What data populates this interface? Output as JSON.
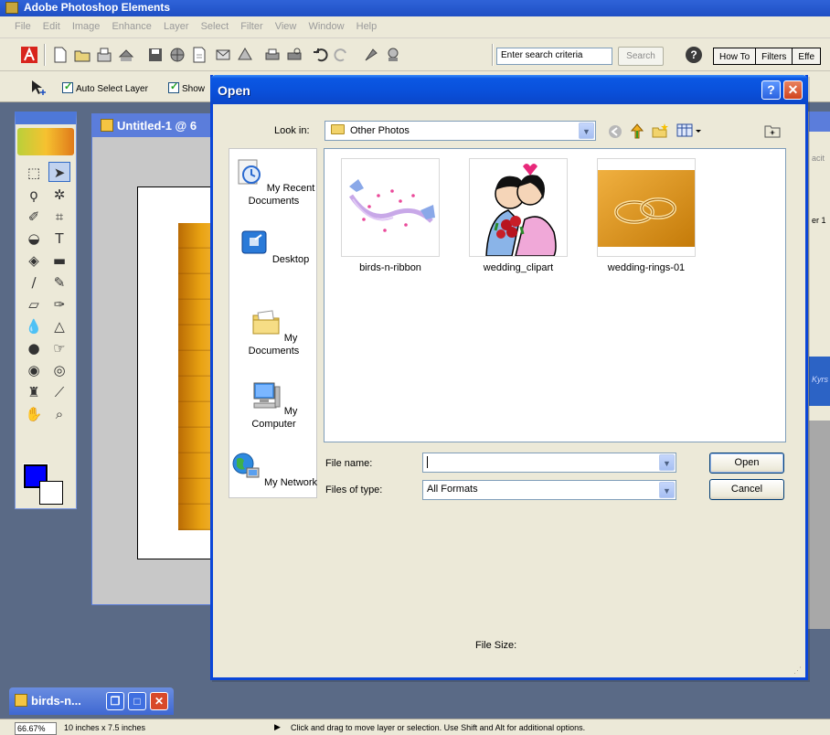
{
  "app": {
    "title": "Adobe Photoshop Elements",
    "menu": [
      "File",
      "Edit",
      "Image",
      "Enhance",
      "Layer",
      "Select",
      "Filter",
      "View",
      "Window",
      "Help"
    ],
    "search_placeholder": "Enter search criteria",
    "search_button": "Search",
    "help_glyph": "?",
    "palette_tabs": [
      "How To",
      "Filters",
      "Effe"
    ],
    "options": {
      "auto_select_layer": "Auto Select Layer",
      "show": "Show"
    },
    "document_title": "Untitled-1 @ 6",
    "palette_fragments": [
      "acit",
      "er 1",
      "Kyrs"
    ],
    "minimized_document": "birds-n...",
    "status": {
      "zoom": "66.67%",
      "doc_size": "10 inches x 7.5 inches",
      "message": "Click and drag to move layer or selection.  Use Shift and Alt for additional options."
    },
    "colors": {
      "foreground": "#0000ff",
      "background": "#ffffff"
    }
  },
  "dialog": {
    "title": "Open",
    "look_in_label": "Look in:",
    "look_in_value": "Other Photos",
    "places": [
      {
        "label": "My Recent Documents",
        "icon": "recent-documents-icon"
      },
      {
        "label": "Desktop",
        "icon": "desktop-icon"
      },
      {
        "label": "My Documents",
        "icon": "my-documents-icon"
      },
      {
        "label": "My Computer",
        "icon": "my-computer-icon"
      },
      {
        "label": "My Network",
        "icon": "my-network-icon"
      }
    ],
    "files": [
      {
        "name": "birds-n-ribbon",
        "thumbnail": "birds-ribbon-image"
      },
      {
        "name": "wedding_clipart",
        "thumbnail": "wedding-couple-image"
      },
      {
        "name": "wedding-rings-01",
        "thumbnail": "wedding-rings-image"
      }
    ],
    "file_name_label": "File name:",
    "file_name_value": "",
    "files_of_type_label": "Files of type:",
    "files_of_type_value": "All Formats",
    "open_button": "Open",
    "cancel_button": "Cancel",
    "file_size_label": "File Size:"
  }
}
